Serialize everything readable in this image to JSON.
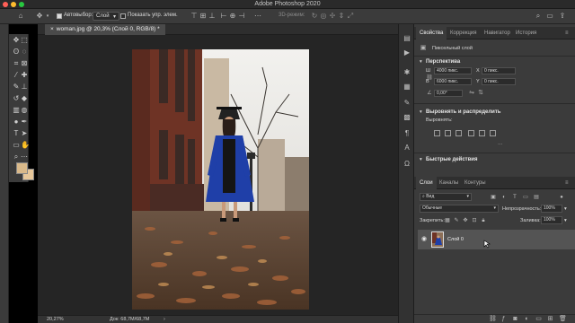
{
  "app": {
    "title": "Adobe Photoshop 2020"
  },
  "options": {
    "autoselect_label": "Автовыбор:",
    "autoselect_value": "Слой",
    "show_controls_label": "Показать упр. элем.",
    "mode_3d_label": "3D-режим:"
  },
  "document": {
    "tab_title": "woman.jpg @ 20,3% (Слой 0, RGB/8) *",
    "zoom": "20,27%",
    "doc_info": "Док: 68,7M/68,7M"
  },
  "properties": {
    "tabs": [
      "Свойства",
      "Коррекция",
      "Навигатор",
      "История"
    ],
    "pixel_layer_label": "Пиксельный слой",
    "transform_section": "Перспектива",
    "w_label": "Ш",
    "w_value": "4000 пикс.",
    "h_label": "В",
    "h_value": "6000 пикс.",
    "x_label": "X",
    "x_value": "0 пикс.",
    "y_label": "Y",
    "y_value": "0 пикс.",
    "angle_value": "0,00°",
    "align_section": "Выровнять и распределить",
    "align_label": "Выровнять:",
    "quick_actions": "Быстрые действия"
  },
  "layers": {
    "tabs": [
      "Слои",
      "Каналы",
      "Контуры"
    ],
    "kind_filter": "Вид",
    "blend_mode": "Обычные",
    "opacity_label": "Непрозрачность:",
    "opacity_value": "100%",
    "lock_label": "Закрепить:",
    "fill_label": "Заливка:",
    "fill_value": "100%",
    "items": [
      {
        "name": "Слой 0",
        "visible": true
      }
    ]
  },
  "colors": {
    "foreground": "#d9b98a",
    "background": "#e7c79a"
  },
  "icons": {
    "home": "home-icon",
    "move": "move-icon",
    "eye": "eye-icon"
  }
}
